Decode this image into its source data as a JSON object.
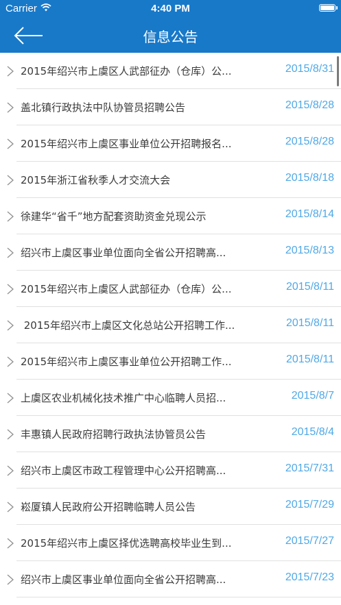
{
  "status_bar": {
    "carrier": "Carrier",
    "time": "4:40 PM"
  },
  "nav": {
    "title": "信息公告"
  },
  "items": [
    {
      "title": "2015年绍兴市上虞区人武部征办（仓库）公...",
      "date": "2015/8/31"
    },
    {
      "title": "盖北镇行政执法中队协管员招聘公告",
      "date": "2015/8/28"
    },
    {
      "title": "2015年绍兴市上虞区事业单位公开招聘报名...",
      "date": "2015/8/28"
    },
    {
      "title": "2015年浙江省秋季人才交流大会",
      "date": "2015/8/18"
    },
    {
      "title": "徐建华“省千”地方配套资助资金兑现公示",
      "date": "2015/8/14"
    },
    {
      "title": "绍兴市上虞区事业单位面向全省公开招聘高...",
      "date": "2015/8/13"
    },
    {
      "title": "2015年绍兴市上虞区人武部征办（仓库）公...",
      "date": "2015/8/11"
    },
    {
      "title": " 2015年绍兴市上虞区文化总站公开招聘工作...",
      "date": "2015/8/11"
    },
    {
      "title": "2015年绍兴市上虞区事业单位公开招聘工作...",
      "date": "2015/8/11"
    },
    {
      "title": "上虞区农业机械化技术推广中心临聘人员招...",
      "date": "2015/8/7"
    },
    {
      "title": "丰惠镇人民政府招聘行政执法协管员公告",
      "date": "2015/8/4"
    },
    {
      "title": "绍兴市上虞区市政工程管理中心公开招聘高...",
      "date": "2015/7/31"
    },
    {
      "title": "崧厦镇人民政府公开招聘临聘人员公告",
      "date": "2015/7/29"
    },
    {
      "title": "2015年绍兴市上虞区择优选聘高校毕业生到...",
      "date": "2015/7/27"
    },
    {
      "title": "绍兴市上虞区事业单位面向全省公开招聘高...",
      "date": "2015/7/23"
    }
  ],
  "colors": {
    "nav_bg": "#1879c9",
    "date_text": "#4fa8e6",
    "title_text": "#3a3a3a"
  },
  "icons": {
    "back": "arrow-left-icon",
    "row": "chevron-right-icon",
    "wifi": "wifi-icon",
    "battery": "battery-icon"
  }
}
